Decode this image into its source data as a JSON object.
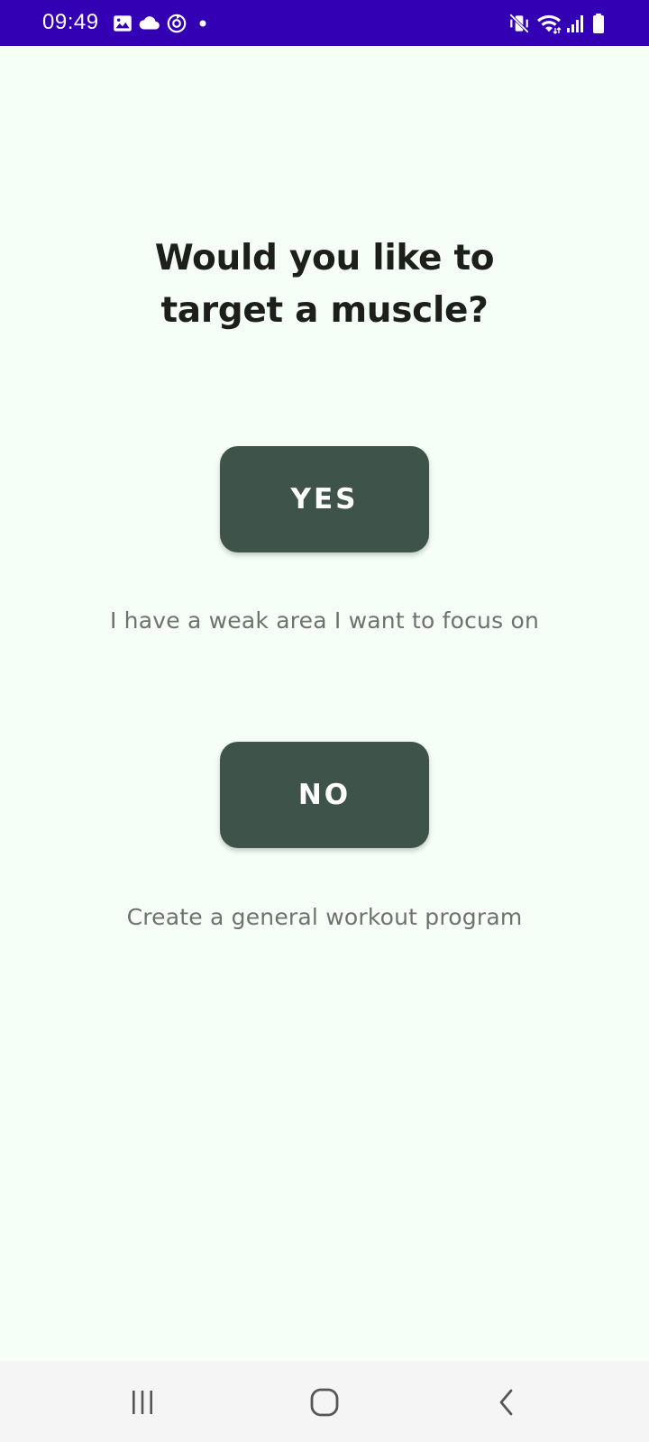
{
  "status_bar": {
    "time": "09:49",
    "icons": [
      "image-icon",
      "cloud-icon",
      "sync-icon",
      "notification-dot-icon",
      "vibrate-mute-icon",
      "wifi-icon",
      "signal-icon",
      "battery-icon"
    ],
    "background": "#3400b3"
  },
  "main": {
    "title_line1": "Would you like to",
    "title_line2": "target a muscle?",
    "yes_label": "YES",
    "yes_description": "I have a weak area I want to focus on",
    "no_label": "NO",
    "no_description": "Create a general workout program",
    "button_color": "#3e544a",
    "background": "#f5fff7"
  },
  "nav_bar": {
    "icons": [
      "recent-apps-icon",
      "home-icon",
      "back-icon"
    ]
  }
}
